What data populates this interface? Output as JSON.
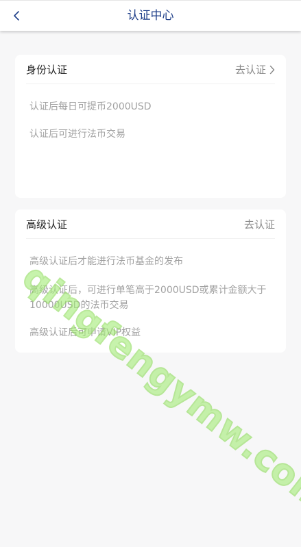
{
  "header": {
    "title": "认证中心",
    "back_icon": "chevron-left-icon"
  },
  "identity": {
    "title": "身份认证",
    "action": "去认证",
    "action_icon": "chevron-right-icon",
    "items": [
      "认证后每日可提币2000USD",
      "认证后可进行法币交易"
    ]
  },
  "advanced": {
    "title": "高级认证",
    "action": "去认证",
    "items": [
      "高级认证后才能进行法币基金的发布",
      "高级认证后，可进行单笔高于2000USD或累计金额大于10000USD的法币交易",
      "高级认证后可申请VIP权益"
    ]
  },
  "watermark": "qingfengymw.com",
  "colors": {
    "title": "#20408a",
    "watermark": "#a6ec7a",
    "background": "#f7f7f8"
  }
}
